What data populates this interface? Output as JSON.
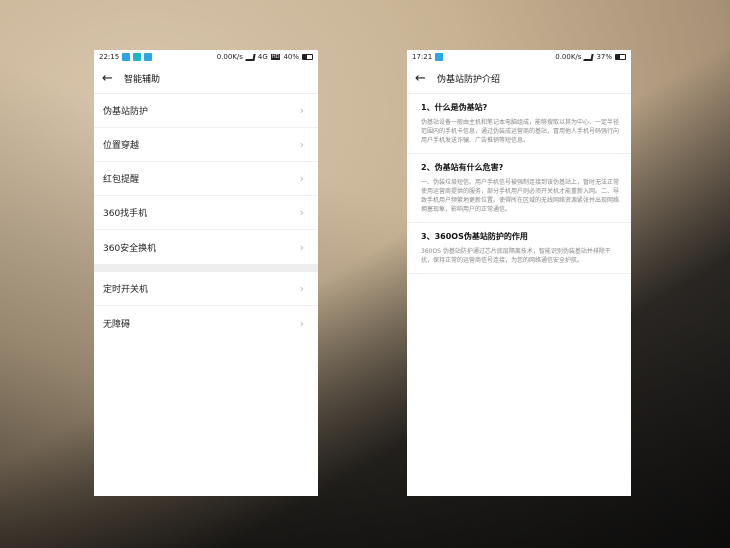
{
  "left_phone": {
    "status": {
      "time": "22:15",
      "speed": "0.00K/s",
      "network": "4G",
      "hd": "HD",
      "battery": "40%"
    },
    "header": {
      "title": "智能辅助"
    },
    "group1": [
      {
        "label": "伪基站防护"
      },
      {
        "label": "位置穿越"
      },
      {
        "label": "红包提醒"
      },
      {
        "label": "360找手机"
      },
      {
        "label": "360安全换机"
      }
    ],
    "group2": [
      {
        "label": "定时开关机"
      },
      {
        "label": "无障碍"
      }
    ]
  },
  "right_phone": {
    "status": {
      "time": "17:21",
      "speed": "0.00K/s",
      "battery": "37%"
    },
    "header": {
      "title": "伪基站防护介绍"
    },
    "sections": [
      {
        "title": "1、什么是伪基站?",
        "body": "伪基站设备一般由主机和笔记本电脑组成，能够搜取以其为中心、一定半径范围内的手机卡信息，通过伪装成运营商的基站，冒用他人手机号码强行向用户手机发送诈骗、广告推销等短信息。"
      },
      {
        "title": "2、伪基站有什么危害?",
        "body": "一、伪装垃圾短信。用户手机信号被强制连接到该伪基站上，暂时无法正常使用运营商提供的服务，部分手机用户则必须开关机才能重新入网。二、导致手机用户频繁地更新位置。使得所在区域的无线网络资源紧张并出现网络拥塞现象，影响用户的正常通信。"
      },
      {
        "title": "3、360OS伪基站防护的作用",
        "body": "360OS 伪基站防护通过芯片底层隔离技术，智能识别伪装基站并排除干扰，保持正常的运营商信号连接，为您的网络通信安全护航。"
      }
    ]
  },
  "icons": {
    "back": "←",
    "chevron": "›"
  },
  "colors": {
    "app_icon": "#2aa6e8",
    "chevron": "#bbbbbb",
    "body_text": "#888888"
  }
}
